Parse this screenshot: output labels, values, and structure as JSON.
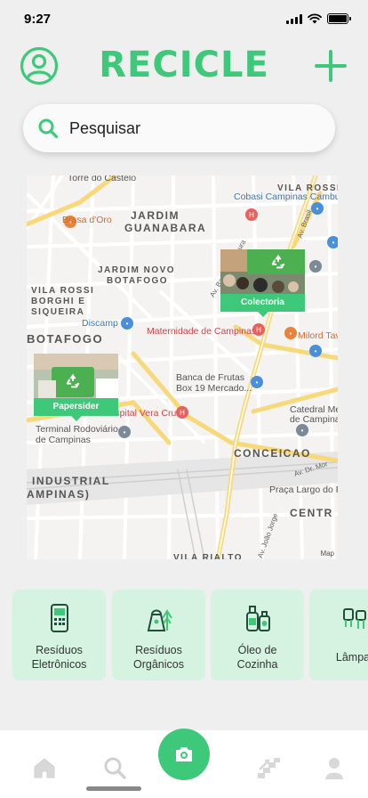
{
  "status_bar": {
    "time": "9:27"
  },
  "header": {
    "title": "RECICLE",
    "profile_icon": "user-circle-icon",
    "add_icon": "plus-icon"
  },
  "search": {
    "placeholder": "Pesquisar",
    "icon": "search-icon"
  },
  "map": {
    "neighborhoods": [
      "JARDIM",
      "GUANABARA",
      "JARDIM NOVO",
      "BOTAFOGO",
      "VILA ROSSI",
      "BORGHI E",
      "SIQUEIRA",
      "BOTAFOGO",
      "CONCEICAO",
      "INDUSTRIAL",
      "AMPINAS)",
      "VILA ROSSI",
      "CENTR",
      "VILA RIALTO"
    ],
    "pois": {
      "torre": "Torre do Castelo",
      "brasa": "Brasa d'Oro",
      "cobasi": "Cobasi Campinas Cambuí",
      "discamp": "Discamp",
      "maternidade": "Maternidade de Campinas",
      "milord": "Milord Tav",
      "banca_1": "Banca de Frutas",
      "banca_2": "Box 19 Mercado...",
      "hospital": "Hospital Vera Cruz",
      "catedral_1": "Catedral Met",
      "catedral_2": "de Campinas",
      "terminal_1": "Terminal Rodoviário",
      "terminal_2": "de Campinas",
      "praca": "Praça Largo do Pa"
    },
    "streets": {
      "brasil": "Av. Brasil",
      "barao": "Av. Barão de Itapura",
      "dr_mor": "Av. Dr. Mor",
      "joao_jorge": "Av. João Jorge"
    },
    "attribution": "Map",
    "markers": [
      {
        "label": "Papersider",
        "icon": "recycle-icon"
      },
      {
        "label": "Colectoria",
        "icon": "recycle-icon"
      }
    ]
  },
  "categories": [
    {
      "label_1": "Resíduos",
      "label_2": "Eletrônicos",
      "icon": "electronics-icon"
    },
    {
      "label_1": "Resíduos",
      "label_2": "Orgânicos",
      "icon": "organic-icon"
    },
    {
      "label_1": "Óleo de",
      "label_2": "Cozinha",
      "icon": "oil-bottle-icon"
    },
    {
      "label_1": "Lâmpad",
      "label_2": "",
      "icon": "lamp-icon"
    }
  ],
  "bottom_nav": {
    "items": [
      "home-icon",
      "search-icon",
      "camera-icon",
      "stairs-icon",
      "person-icon"
    ]
  },
  "colors": {
    "accent": "#3ec97a",
    "card_bg": "#d6f3e2"
  }
}
